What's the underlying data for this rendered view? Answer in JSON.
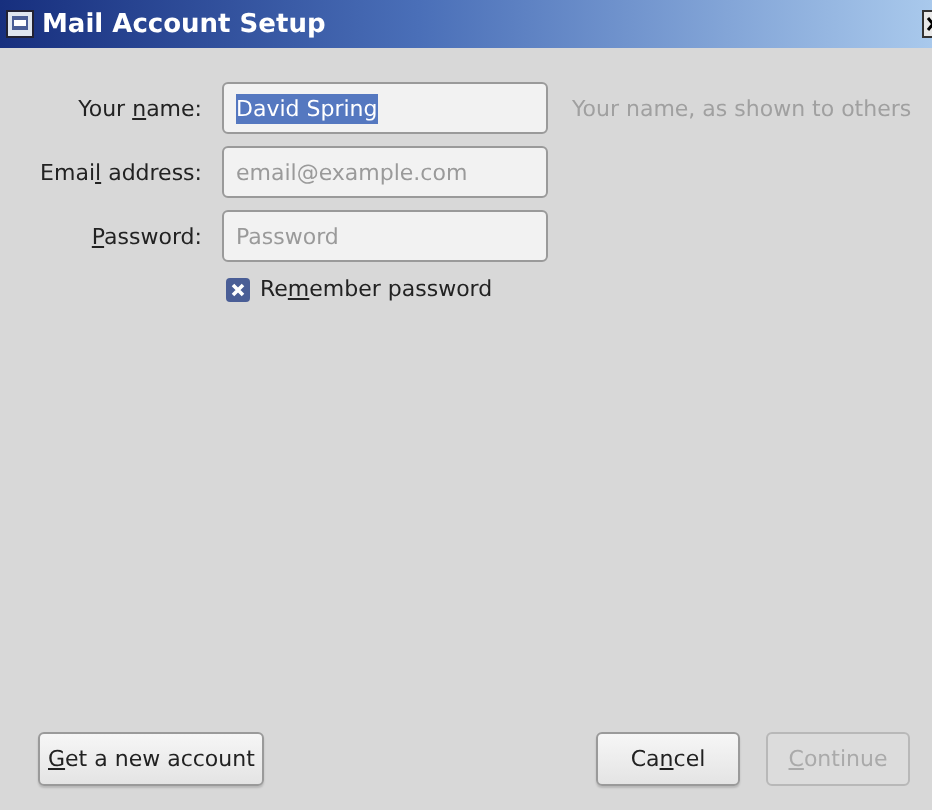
{
  "window": {
    "title": "Mail Account Setup"
  },
  "fields": [
    {
      "label": {
        "before": "Your ",
        "key": "n",
        "after": "ame:"
      },
      "value": "David Spring",
      "value_selected": true,
      "hint": "Your name, as shown to others"
    },
    {
      "label": {
        "before": "Emai",
        "key": "l",
        "after": " address:"
      },
      "placeholder": "email@example.com"
    },
    {
      "label": {
        "key": "P",
        "after": "assword:"
      },
      "placeholder": "Password"
    }
  ],
  "remember": {
    "label": {
      "before": "Re",
      "key": "m",
      "after": "ember password"
    },
    "checked": true
  },
  "left_buttons": [
    {
      "label": {
        "key": "G",
        "after": "et a new account"
      },
      "disabled": false
    }
  ],
  "right_buttons": [
    {
      "label": {
        "before": "Ca",
        "key": "n",
        "after": "cel"
      },
      "disabled": false
    },
    {
      "label": {
        "key": "C",
        "after": "ontinue"
      },
      "disabled": true
    }
  ]
}
